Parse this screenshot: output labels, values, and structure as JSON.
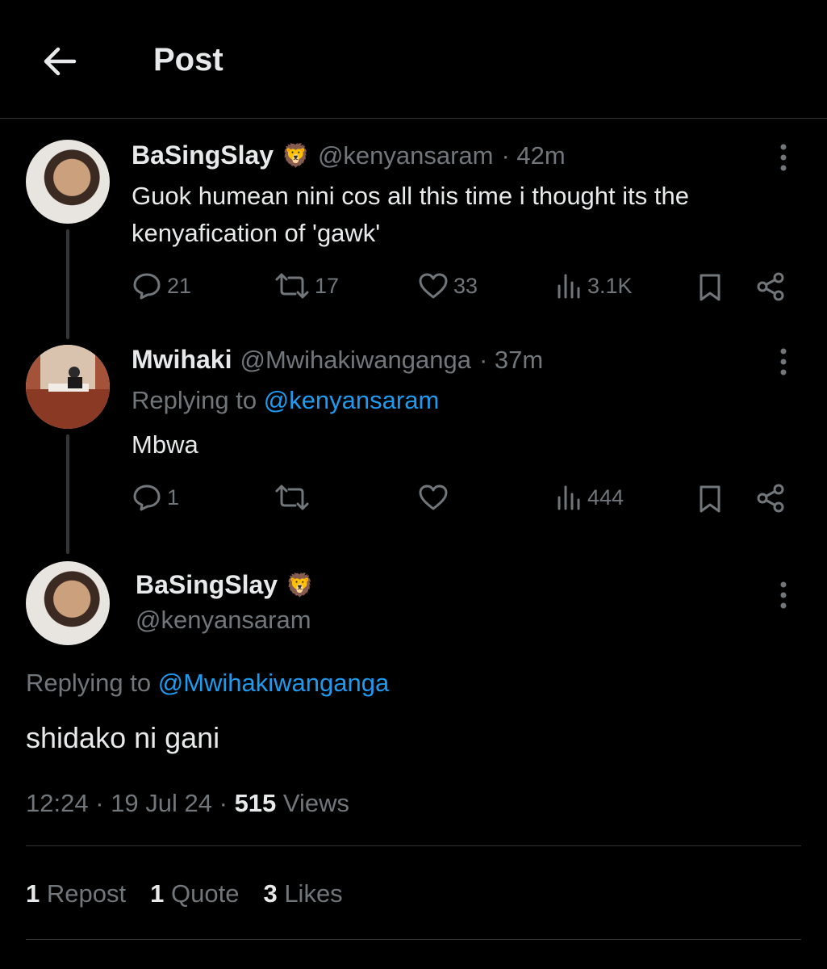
{
  "header": {
    "title": "Post"
  },
  "thread": [
    {
      "display_name": "BaSingSlay",
      "emoji": "🦁",
      "handle": "@kenyansaram",
      "time": "· 42m",
      "text_line1": "Guok humean nini cos all this time i thought its the",
      "text_line2": "kenyafication of 'gawk'",
      "replies": "21",
      "reposts": "17",
      "likes": "33",
      "views": "3.1K"
    },
    {
      "display_name": "Mwihaki",
      "handle": "@Mwihakiwanganga",
      "time": "· 37m",
      "replying_prefix": "Replying to",
      "replying_to": "@kenyansaram",
      "text": "Mbwa",
      "replies": "1",
      "views": "444"
    }
  ],
  "main_post": {
    "display_name": "BaSingSlay",
    "emoji": "🦁",
    "handle": "@kenyansaram",
    "replying_prefix": "Replying to",
    "replying_to": "@Mwihakiwanganga",
    "text": "shidako ni gani",
    "time": "12:24",
    "date": "19 Jul 24",
    "views_count": "515",
    "views_label": "Views",
    "repost_count": "1",
    "repost_label": "Repost",
    "quote_count": "1",
    "quote_label": "Quote",
    "likes_count": "3",
    "likes_label": "Likes"
  },
  "colors": {
    "background": "#000000",
    "text": "#e7e9ea",
    "muted": "#71767b",
    "link": "#1d9bf0",
    "divider": "#2f3336"
  }
}
